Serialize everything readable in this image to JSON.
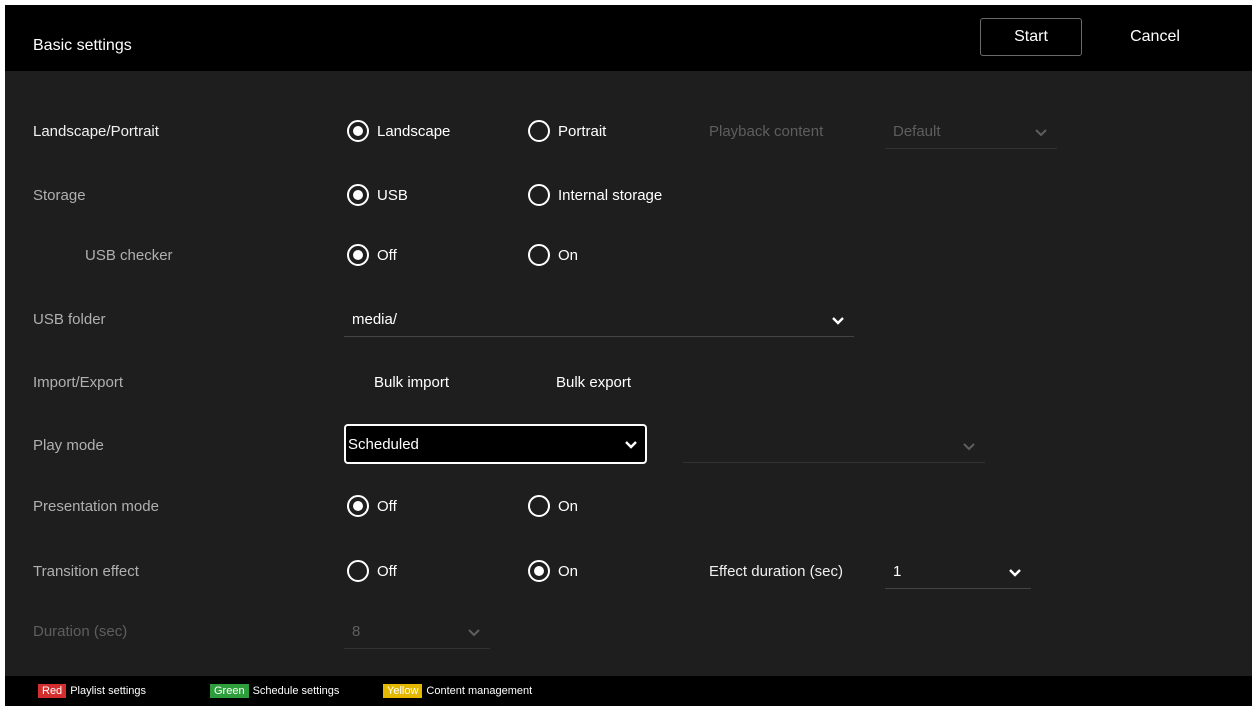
{
  "header": {
    "title": "Basic settings",
    "start_label": "Start",
    "cancel_label": "Cancel"
  },
  "rows": {
    "orientation": {
      "label": "Landscape/Portrait",
      "options": [
        "Landscape",
        "Portrait"
      ],
      "selected": "Landscape",
      "playback_label": "Playback content",
      "playback_value": "Default"
    },
    "storage": {
      "label": "Storage",
      "options": [
        "USB",
        "Internal storage"
      ],
      "selected": "USB"
    },
    "usb_checker": {
      "label": "USB checker",
      "options": [
        "Off",
        "On"
      ],
      "selected": "Off"
    },
    "usb_folder": {
      "label": "USB folder",
      "value": "media/"
    },
    "import_export": {
      "label": "Import/Export",
      "bulk_import": "Bulk import",
      "bulk_export": "Bulk export"
    },
    "play_mode": {
      "label": "Play mode",
      "value": "Scheduled",
      "secondary_value": ""
    },
    "presentation_mode": {
      "label": "Presentation mode",
      "options": [
        "Off",
        "On"
      ],
      "selected": "Off"
    },
    "transition_effect": {
      "label": "Transition effect",
      "options": [
        "Off",
        "On"
      ],
      "selected": "On",
      "effect_duration_label": "Effect duration (sec)",
      "effect_duration_value": "1"
    },
    "duration": {
      "label": "Duration (sec)",
      "value": "8"
    }
  },
  "footer": {
    "red": {
      "tag": "Red",
      "label": "Playlist settings",
      "color": "#d32f2f"
    },
    "green": {
      "tag": "Green",
      "label": "Schedule settings",
      "color": "#2e9e3c"
    },
    "yellow": {
      "tag": "Yellow",
      "label": "Content management",
      "color": "#e5b800"
    }
  }
}
